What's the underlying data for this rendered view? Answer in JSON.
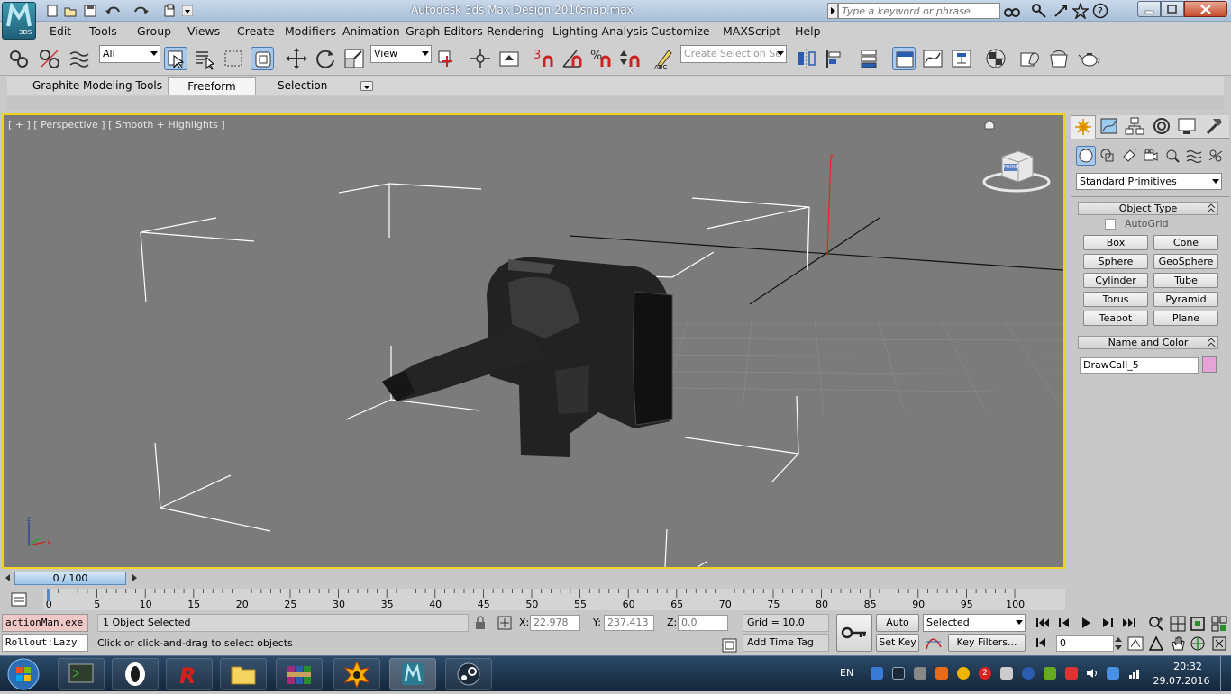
{
  "window": {
    "app_title": "Autodesk 3ds Max Design 2010",
    "file_name": "snap.max",
    "search_placeholder": "Type a keyword or phrase",
    "logo_text": "3DS"
  },
  "menu": [
    "Edit",
    "Tools",
    "Group",
    "Views",
    "Create",
    "Modifiers",
    "Animation",
    "Graph Editors",
    "Rendering",
    "Lighting Analysis",
    "Customize",
    "MAXScript",
    "Help"
  ],
  "toolbar": {
    "selection_filter": "All",
    "reference_coord": "View",
    "named_selection_placeholder": "Create Selection Se",
    "snap_label": "3",
    "percent_label": "%"
  },
  "ribbon": {
    "tabs": [
      "Graphite Modeling Tools",
      "Freeform",
      "Selection"
    ],
    "active_tab": "Freeform"
  },
  "viewport": {
    "label": "[ + ] [ Perspective ] [ Smooth + Highlights ]",
    "viewcube_label": "FRONT",
    "axis_z": "z",
    "axis_x": "x"
  },
  "command_panel": {
    "category": "Standard Primitives",
    "object_type_title": "Object Type",
    "autogrid_label": "AutoGrid",
    "buttons": [
      "Box",
      "Cone",
      "Sphere",
      "GeoSphere",
      "Cylinder",
      "Tube",
      "Torus",
      "Pyramid",
      "Teapot",
      "Plane"
    ],
    "name_color_title": "Name and Color",
    "object_name": "DrawCall_5",
    "object_color": "#e6a3d6"
  },
  "timeline": {
    "slider_label": "0 / 100",
    "ticks": [
      "0",
      "5",
      "10",
      "15",
      "20",
      "25",
      "30",
      "35",
      "40",
      "45",
      "50",
      "55",
      "60",
      "65",
      "70",
      "75",
      "80",
      "85",
      "90",
      "95",
      "100"
    ]
  },
  "status": {
    "maxscript_line1": "actionMan.exe",
    "maxscript_line2": "Rollout:Lazy",
    "selection_status": "1 Object Selected",
    "prompt": "Click or click-and-drag to select objects",
    "x_label": "X:",
    "x_value": "22,978",
    "y_label": "Y:",
    "y_value": "237,413",
    "z_label": "Z:",
    "z_value": "0,0",
    "grid": "Grid = 10,0",
    "add_time_tag": "Add Time Tag",
    "auto_key": "Auto Key",
    "set_key": "Set Key",
    "key_mode": "Selected",
    "key_filters": "Key Filters...",
    "current_frame": "0"
  },
  "taskbar": {
    "language": "EN",
    "time": "20:32",
    "date": "29.07.2016",
    "badge_count": "2"
  }
}
